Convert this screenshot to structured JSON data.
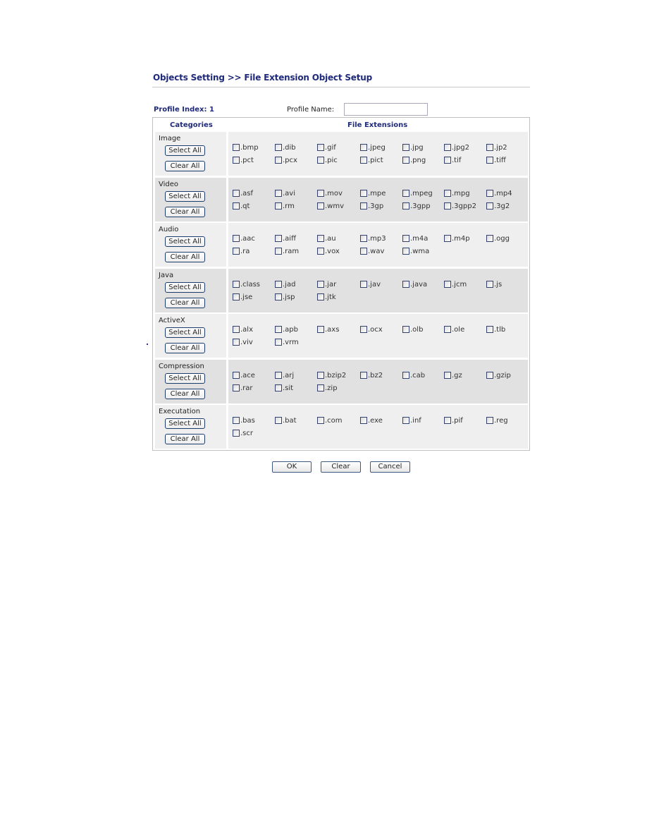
{
  "header": {
    "title": "Objects Setting >> File Extension Object Setup"
  },
  "profile": {
    "index_label": "Profile Index: 1",
    "name_label": "Profile Name:",
    "name_value": "",
    "name_placeholder": ""
  },
  "table": {
    "col_categories": "Categories",
    "col_extensions": "File Extensions",
    "categories": [
      {
        "name": "Image",
        "select_all": "Select All",
        "clear_all": "Clear All",
        "extensions": [
          {
            "label": ".bmp",
            "checked": false
          },
          {
            "label": ".dib",
            "checked": false
          },
          {
            "label": ".gif",
            "checked": false
          },
          {
            "label": ".jpeg",
            "checked": false
          },
          {
            "label": ".jpg",
            "checked": false
          },
          {
            "label": ".jpg2",
            "checked": false
          },
          {
            "label": ".jp2",
            "checked": false
          },
          {
            "label": ".pct",
            "checked": false
          },
          {
            "label": ".pcx",
            "checked": false
          },
          {
            "label": ".pic",
            "checked": false
          },
          {
            "label": ".pict",
            "checked": false
          },
          {
            "label": ".png",
            "checked": false
          },
          {
            "label": ".tif",
            "checked": false
          },
          {
            "label": ".tiff",
            "checked": false
          }
        ]
      },
      {
        "name": "Video",
        "select_all": "Select All",
        "clear_all": "Clear All",
        "extensions": [
          {
            "label": ".asf",
            "checked": false
          },
          {
            "label": ".avi",
            "checked": false
          },
          {
            "label": ".mov",
            "checked": false
          },
          {
            "label": ".mpe",
            "checked": false
          },
          {
            "label": ".mpeg",
            "checked": false
          },
          {
            "label": ".mpg",
            "checked": false
          },
          {
            "label": ".mp4",
            "checked": false
          },
          {
            "label": ".qt",
            "checked": false
          },
          {
            "label": ".rm",
            "checked": false
          },
          {
            "label": ".wmv",
            "checked": false
          },
          {
            "label": ".3gp",
            "checked": false
          },
          {
            "label": ".3gpp",
            "checked": false
          },
          {
            "label": ".3gpp2",
            "checked": false
          },
          {
            "label": ".3g2",
            "checked": false
          }
        ]
      },
      {
        "name": "Audio",
        "select_all": "Select All",
        "clear_all": "Clear All",
        "extensions": [
          {
            "label": ".aac",
            "checked": false
          },
          {
            "label": ".aiff",
            "checked": false
          },
          {
            "label": ".au",
            "checked": false
          },
          {
            "label": ".mp3",
            "checked": false
          },
          {
            "label": ".m4a",
            "checked": false
          },
          {
            "label": ".m4p",
            "checked": false
          },
          {
            "label": ".ogg",
            "checked": false
          },
          {
            "label": ".ra",
            "checked": false
          },
          {
            "label": ".ram",
            "checked": false
          },
          {
            "label": ".vox",
            "checked": false
          },
          {
            "label": ".wav",
            "checked": false
          },
          {
            "label": ".wma",
            "checked": false
          }
        ]
      },
      {
        "name": "Java",
        "select_all": "Select All",
        "clear_all": "Clear All",
        "extensions": [
          {
            "label": ".class",
            "checked": false
          },
          {
            "label": ".jad",
            "checked": false
          },
          {
            "label": ".jar",
            "checked": false
          },
          {
            "label": ".jav",
            "checked": false
          },
          {
            "label": ".java",
            "checked": false
          },
          {
            "label": ".jcm",
            "checked": false
          },
          {
            "label": ".js",
            "checked": false
          },
          {
            "label": ".jse",
            "checked": false
          },
          {
            "label": ".jsp",
            "checked": false
          },
          {
            "label": ".jtk",
            "checked": false
          }
        ]
      },
      {
        "name": "ActiveX",
        "select_all": "Select All",
        "clear_all": "Clear All",
        "extensions": [
          {
            "label": ".alx",
            "checked": false
          },
          {
            "label": ".apb",
            "checked": false
          },
          {
            "label": ".axs",
            "checked": false
          },
          {
            "label": ".ocx",
            "checked": false
          },
          {
            "label": ".olb",
            "checked": false
          },
          {
            "label": ".ole",
            "checked": false
          },
          {
            "label": ".tlb",
            "checked": false
          },
          {
            "label": ".viv",
            "checked": false
          },
          {
            "label": ".vrm",
            "checked": false
          }
        ]
      },
      {
        "name": "Compression",
        "select_all": "Select All",
        "clear_all": "Clear All",
        "extensions": [
          {
            "label": ".ace",
            "checked": false
          },
          {
            "label": ".arj",
            "checked": false
          },
          {
            "label": ".bzip2",
            "checked": false
          },
          {
            "label": ".bz2",
            "checked": false
          },
          {
            "label": ".cab",
            "checked": false
          },
          {
            "label": ".gz",
            "checked": false
          },
          {
            "label": ".gzip",
            "checked": false
          },
          {
            "label": ".rar",
            "checked": false
          },
          {
            "label": ".sit",
            "checked": false
          },
          {
            "label": ".zip",
            "checked": false
          }
        ]
      },
      {
        "name": "Executation",
        "select_all": "Select All",
        "clear_all": "Clear All",
        "extensions": [
          {
            "label": ".bas",
            "checked": false
          },
          {
            "label": ".bat",
            "checked": false
          },
          {
            "label": ".com",
            "checked": false
          },
          {
            "label": ".exe",
            "checked": false
          },
          {
            "label": ".inf",
            "checked": false
          },
          {
            "label": ".pif",
            "checked": false
          },
          {
            "label": ".reg",
            "checked": false
          },
          {
            "label": ".scr",
            "checked": false
          }
        ]
      }
    ]
  },
  "footer": {
    "ok_label": "OK",
    "clear_label": "Clear",
    "cancel_label": "Cancel"
  },
  "colors": {
    "heading": "#1f2a7a",
    "row_light": "#efefef",
    "row_dark": "#e1e1e1",
    "button_border": "#1c3c6a"
  }
}
